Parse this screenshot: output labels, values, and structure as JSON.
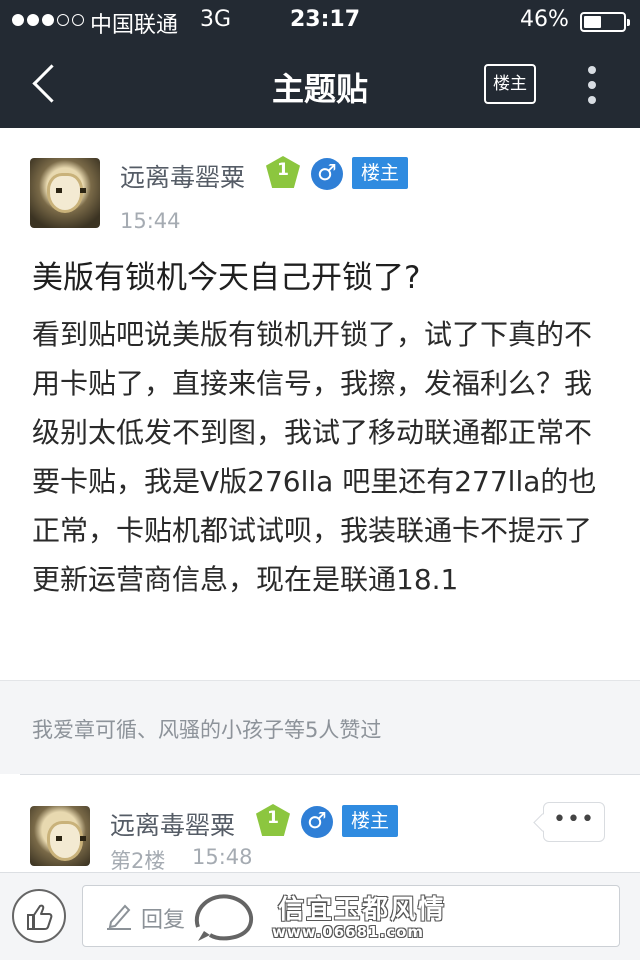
{
  "status_bar": {
    "signal_filled": 3,
    "signal_total": 5,
    "carrier": "中国联通",
    "network": "3G",
    "time": "23:17",
    "battery_text": "46%",
    "battery_level": 0.46
  },
  "nav": {
    "title": "主题贴",
    "op_only_label": "楼主"
  },
  "post": {
    "author": "远离毒罂粟",
    "level": "1",
    "gender_symbol": "♂",
    "op_badge": "楼主",
    "time": "15:44",
    "title": "美版有锁机今天自己开锁了?",
    "body": "看到贴吧说美版有锁机开锁了，试了下真的不用卡贴了，直接来信号，我擦，发福利么？我级别太低发不到图，我试了移动联通都正常不要卡贴，我是V版276lla 吧里还有277lla的也正常，卡贴机都试试呗，我装联通卡不提示了更新运营商信息，现在是联通18.1"
  },
  "likes": {
    "names": "我爱章可循、风骚的小孩子",
    "suffix": "等5人赞过"
  },
  "reply": {
    "author": "远离毒罂粟",
    "level": "1",
    "gender_symbol": "♂",
    "op_badge": "楼主",
    "floor": "第2楼",
    "time": "15:48",
    "more_label": "•••"
  },
  "bottom_bar": {
    "reply_placeholder": "回复"
  },
  "watermark": {
    "title": "信宜玉都风情",
    "url": "www.06681.com"
  },
  "icons": {
    "back": "chevron-left-icon",
    "more_vertical": "more-vertical-icon",
    "like": "thumbs-up-icon",
    "pencil": "pencil-icon"
  },
  "colors": {
    "nav_bg": "#232a33",
    "badge_blue": "#2f8be0",
    "level_green": "#8cc63f",
    "muted_text": "#a5abb2"
  }
}
